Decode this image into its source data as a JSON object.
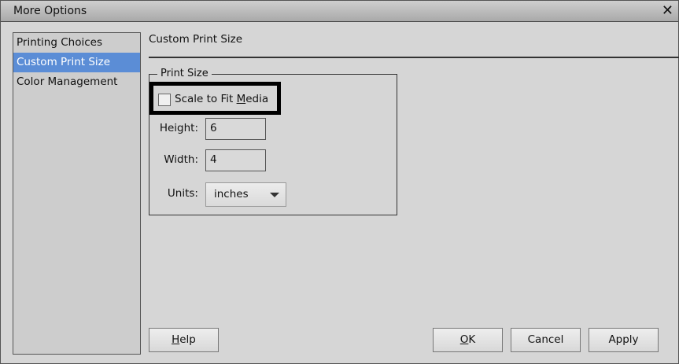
{
  "window": {
    "title": "More Options",
    "close": "✕"
  },
  "sidebar": {
    "items": [
      {
        "label": "Printing Choices"
      },
      {
        "label": "Custom Print Size",
        "selected": true
      },
      {
        "label": "Color Management"
      }
    ]
  },
  "main": {
    "heading": "Custom Print Size",
    "group_label": "Print Size",
    "scale_to_fit": {
      "label_pre": "Scale to Fit ",
      "label_mnemonic": "M",
      "label_post": "edia",
      "checked": false
    },
    "height": {
      "label": "Height:",
      "value": "6"
    },
    "width": {
      "label": "Width:",
      "value": "4"
    },
    "units": {
      "label": "Units:",
      "value": "inches"
    }
  },
  "buttons": {
    "help": {
      "mn": "H",
      "rest": "elp"
    },
    "ok": {
      "mn": "O",
      "rest": "K"
    },
    "cancel": "Cancel",
    "apply": "Apply"
  },
  "colors": {
    "selection": "#5b8dd6",
    "background": "#d6d6d6"
  }
}
